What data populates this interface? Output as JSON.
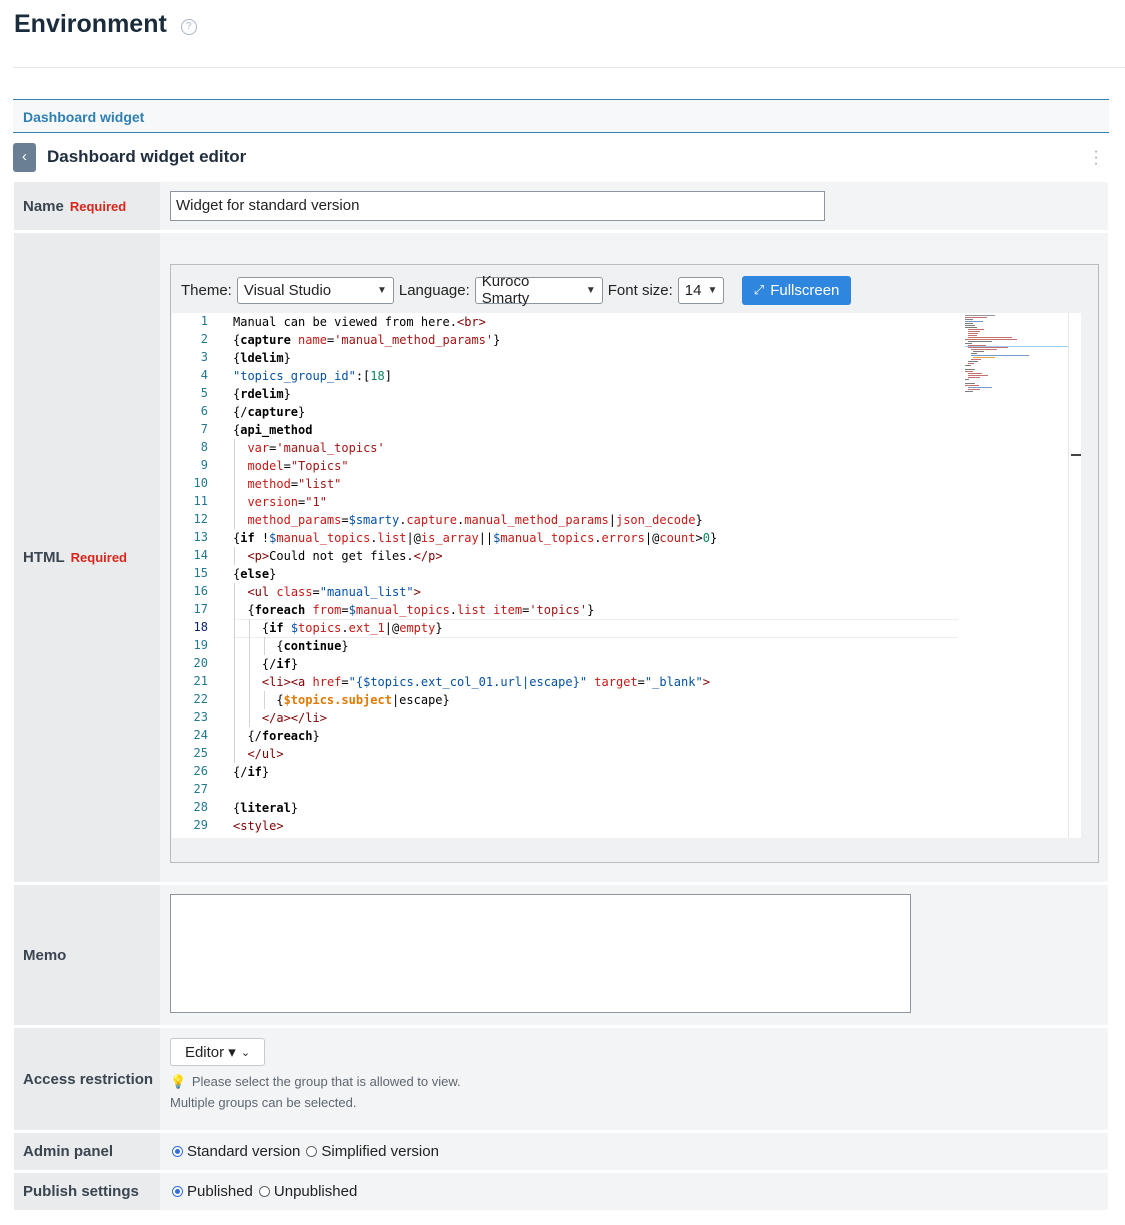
{
  "page": {
    "title": "Environment",
    "help_icon": "question-circle-icon"
  },
  "tab": {
    "label": "Dashboard widget"
  },
  "editor": {
    "back_icon": "chevron-left-icon",
    "title": "Dashboard widget editor",
    "menu_icon": "kebab-menu-icon"
  },
  "form": {
    "required_label": "Required",
    "name": {
      "label": "Name",
      "value": "Widget for standard version"
    },
    "html": {
      "label": "HTML",
      "toolbar": {
        "theme_label": "Theme:",
        "theme_value": "Visual Studio",
        "language_label": "Language:",
        "language_value": "Kuroco Smarty",
        "font_size_label": "Font size:",
        "font_size_value": "14",
        "fullscreen_label": "Fullscreen",
        "fullscreen_icon": "expand-arrows-icon"
      },
      "line_numbers": [
        "1",
        "2",
        "3",
        "4",
        "5",
        "6",
        "7",
        "8",
        "9",
        "10",
        "11",
        "12",
        "13",
        "14",
        "15",
        "16",
        "17",
        "18",
        "19",
        "20",
        "21",
        "22",
        "23",
        "24",
        "25",
        "26",
        "27",
        "28",
        "29"
      ],
      "current_line": 18
    },
    "memo": {
      "label": "Memo",
      "value": ""
    },
    "access": {
      "label": "Access restriction",
      "button": "Editor ▾",
      "hint_icon": "lightbulb-icon",
      "hint_line1": "Please select the group that is allowed to view.",
      "hint_line2": "Multiple groups can be selected."
    },
    "admin_panel": {
      "label": "Admin panel",
      "options": [
        "Standard version",
        "Simplified version"
      ],
      "selected": "Standard version"
    },
    "publish": {
      "label": "Publish settings",
      "options": [
        "Published",
        "Unpublished"
      ],
      "selected": "Published"
    }
  }
}
